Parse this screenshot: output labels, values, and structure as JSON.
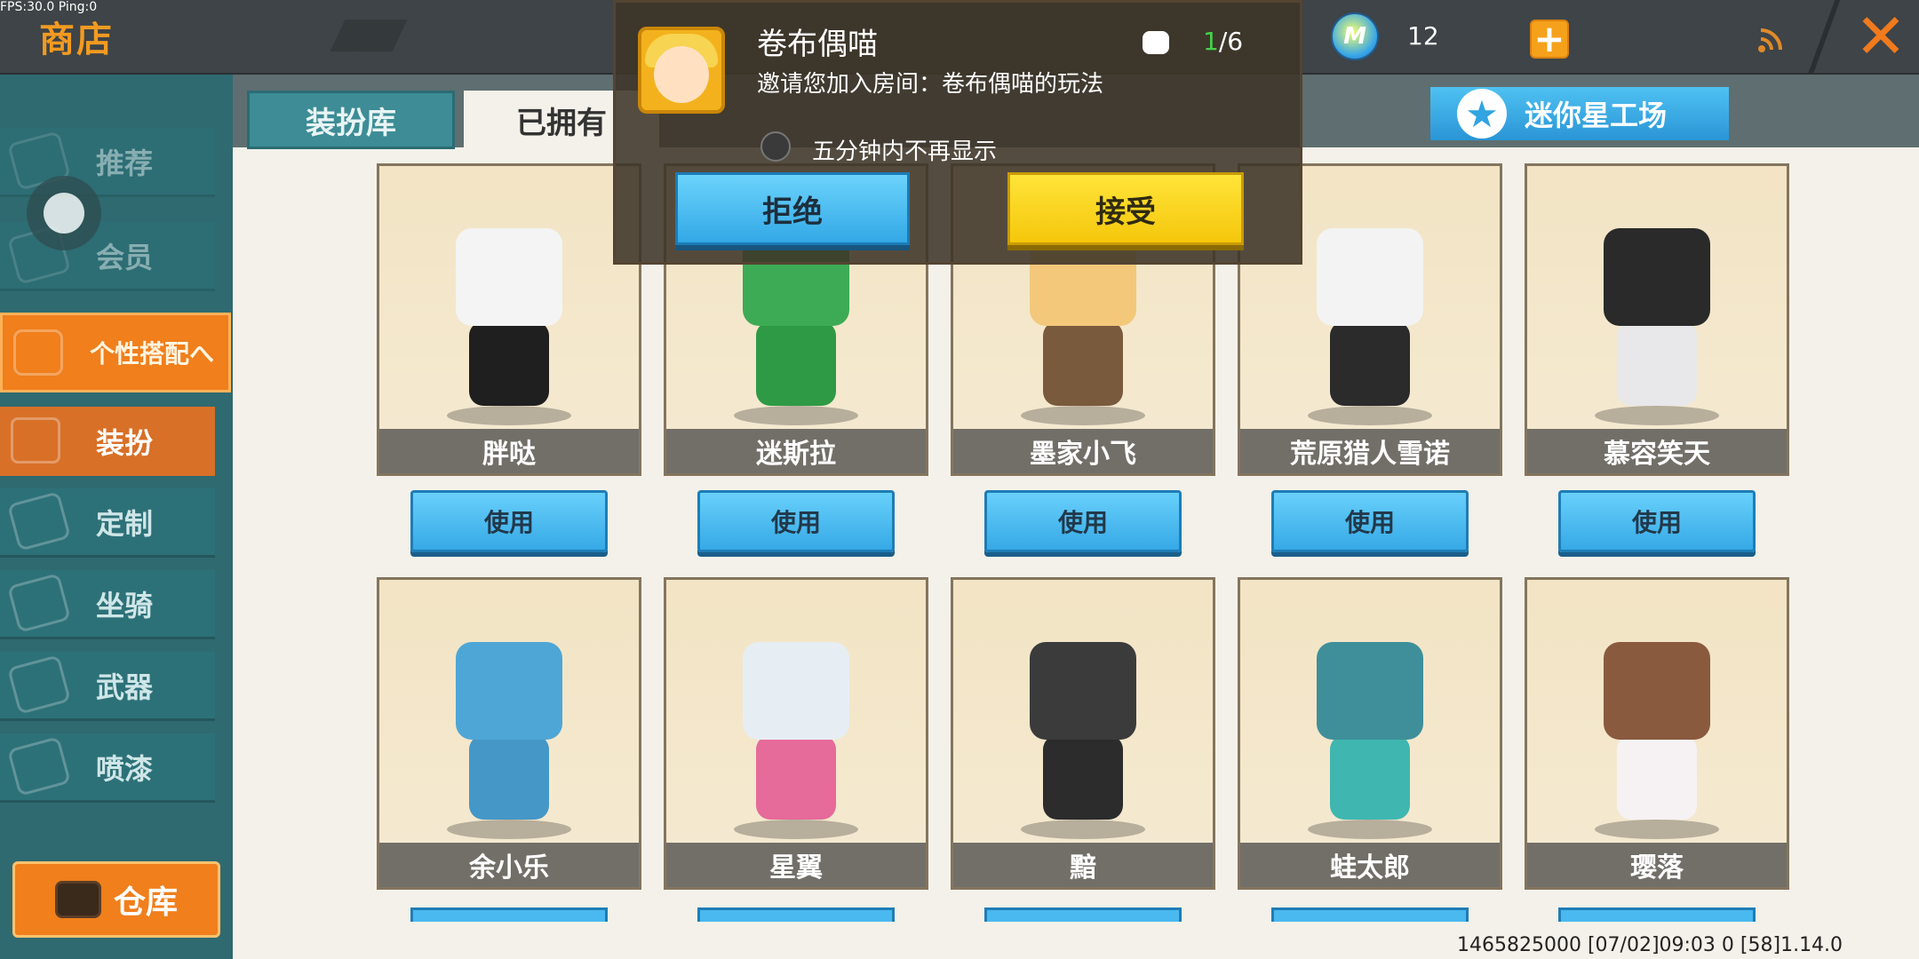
{
  "status": {
    "fps": "FPS:30.0  Ping:0"
  },
  "topbar": {
    "title": "商店",
    "coin_value": "12",
    "coin_icon": "M"
  },
  "tabs": [
    {
      "label": "装扮库"
    },
    {
      "label": "已拥有"
    }
  ],
  "star_workshop": {
    "label": "迷你星工场"
  },
  "sidebar": {
    "items": [
      {
        "label": "推荐"
      },
      {
        "label": "会员"
      },
      {
        "label": "个性搭配へ"
      },
      {
        "label": "装扮"
      },
      {
        "label": "定制"
      },
      {
        "label": "坐骑"
      },
      {
        "label": "武器"
      },
      {
        "label": "喷漆"
      }
    ],
    "warehouse": "仓库"
  },
  "skins_row1": [
    {
      "name": "胖哒",
      "head": "#f4f4f4",
      "body": "#1f1f1f"
    },
    {
      "name": "迷斯拉",
      "head": "#3dab55",
      "body": "#2f9a46"
    },
    {
      "name": "墨家小飞",
      "head": "#f3c87a",
      "body": "#7a5a3c"
    },
    {
      "name": "荒原猎人雪诺",
      "head": "#f3f3f3",
      "body": "#2b2b2b"
    },
    {
      "name": "慕容笑天",
      "head": "#2a2a2a",
      "body": "#e8e8ea"
    }
  ],
  "skins_row2": [
    {
      "name": "余小乐",
      "head": "#4ea6d6",
      "body": "#4597c7"
    },
    {
      "name": "星翼",
      "head": "#e6eef3",
      "body": "#e66a9a"
    },
    {
      "name": "黯",
      "head": "#3b3b3b",
      "body": "#2c2c2c"
    },
    {
      "name": "蛙太郎",
      "head": "#3f8f9a",
      "body": "#3fb7b0"
    },
    {
      "name": "璎落",
      "head": "#8a5a3e",
      "body": "#f6f2f4"
    }
  ],
  "use_label": "使用",
  "footer": "1465825000   [07/02]09:03 0 [58]1.14.0",
  "popup": {
    "name": "卷布偶喵",
    "count_current": "1",
    "count_total": "/6",
    "message": "邀请您加入房间：卷布偶喵的玩法",
    "dont_show": "五分钟内不再显示",
    "reject": "拒绝",
    "accept": "接受"
  }
}
